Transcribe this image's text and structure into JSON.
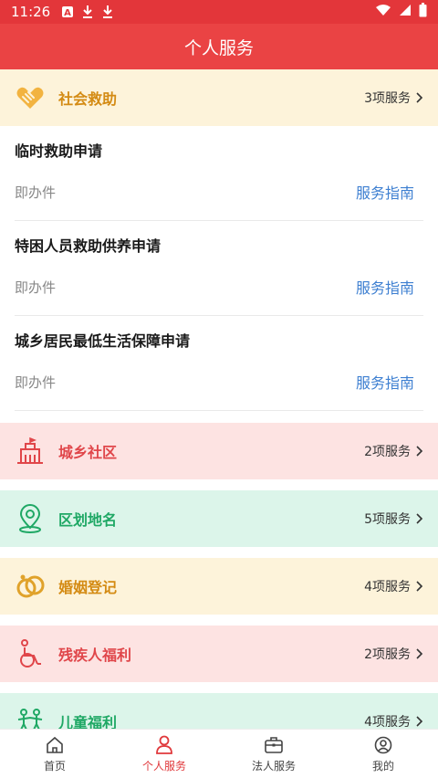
{
  "status_bar": {
    "time": "11:26"
  },
  "header": {
    "title": "个人服务"
  },
  "categories": [
    {
      "title": "社会救助",
      "count": "3项服务",
      "icon": "handshake-icon",
      "theme": "yellow"
    },
    {
      "title": "城乡社区",
      "count": "2项服务",
      "icon": "community-building-icon",
      "theme": "pink"
    },
    {
      "title": "区划地名",
      "count": "5项服务",
      "icon": "map-pin-icon",
      "theme": "green"
    },
    {
      "title": "婚姻登记",
      "count": "4项服务",
      "icon": "rings-icon",
      "theme": "yellow"
    },
    {
      "title": "残疾人福利",
      "count": "2项服务",
      "icon": "wheelchair-icon",
      "theme": "pink"
    },
    {
      "title": "儿童福利",
      "count": "4项服务",
      "icon": "children-icon",
      "theme": "green"
    }
  ],
  "services": [
    {
      "name": "临时救助申请",
      "type": "即办件",
      "guide": "服务指南"
    },
    {
      "name": "特困人员救助供养申请",
      "type": "即办件",
      "guide": "服务指南"
    },
    {
      "name": "城乡居民最低生活保障申请",
      "type": "即办件",
      "guide": "服务指南"
    }
  ],
  "bottom_nav": [
    {
      "label": "首页",
      "icon": "home-icon",
      "active": false
    },
    {
      "label": "个人服务",
      "icon": "person-icon",
      "active": true
    },
    {
      "label": "法人服务",
      "icon": "briefcase-icon",
      "active": false
    },
    {
      "label": "我的",
      "icon": "profile-icon",
      "active": false
    }
  ],
  "colors": {
    "header": "#ea4344",
    "active_nav": "#e0393c",
    "link": "#3d7fd1"
  }
}
